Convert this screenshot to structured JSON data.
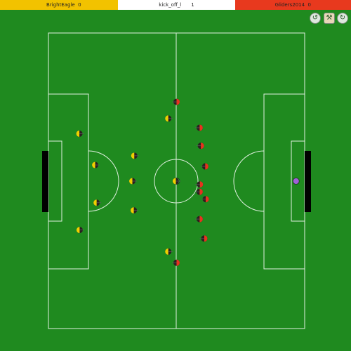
{
  "scoreboard": {
    "left_team": "BrightEagle",
    "left_score": "0",
    "play_mode": "kick_off_l",
    "cycle": "1",
    "right_team": "Gliders2014",
    "right_score": "0"
  },
  "colors": {
    "field": "#1f8a1f",
    "lines": "#e0f0e0",
    "left_bar": "#f2c200",
    "right_bar": "#e8391e",
    "left_player": "#f0d000",
    "right_player": "#e8321e",
    "player_body": "#2a2020",
    "left_goalie": "#2fd060",
    "right_goalie": "#a060d8",
    "goal": "#000000"
  },
  "controls": [
    {
      "name": "rewind-button",
      "icon": "rewind-icon"
    },
    {
      "name": "tools-button",
      "icon": "tools-icon"
    },
    {
      "name": "play-button",
      "icon": "play-icon"
    }
  ],
  "left_team": {
    "name": "BrightEagle",
    "players": [
      {
        "x": 0.0,
        "y": 0.0,
        "goalie": true
      },
      {
        "x": -40.0,
        "y": -20.0
      },
      {
        "x": -33.5,
        "y": -6.8
      },
      {
        "x": -32.9,
        "y": 9.1
      },
      {
        "x": -39.9,
        "y": 20.6
      },
      {
        "x": -17.4,
        "y": -10.7
      },
      {
        "x": -18.2,
        "y": 0.0
      },
      {
        "x": -17.6,
        "y": 12.3
      },
      {
        "x": -3.4,
        "y": -26.4
      },
      {
        "x": -3.4,
        "y": 29.7
      },
      {
        "x": -0.3,
        "y": 0.0
      }
    ]
  },
  "right_team": {
    "name": "Gliders2014",
    "players": [
      {
        "x": 49.2,
        "y": 0.0,
        "goalie": true
      },
      {
        "x": 9.5,
        "y": -22.5
      },
      {
        "x": 10.0,
        "y": -14.9
      },
      {
        "x": 11.8,
        "y": -6.2
      },
      {
        "x": 9.6,
        "y": 1.4
      },
      {
        "x": 9.5,
        "y": 4.5
      },
      {
        "x": 12.0,
        "y": 7.6
      },
      {
        "x": 9.5,
        "y": 16.0
      },
      {
        "x": 11.4,
        "y": 24.2
      },
      {
        "x": 0.0,
        "y": -33.4
      },
      {
        "x": 0.0,
        "y": 34.4
      }
    ]
  }
}
